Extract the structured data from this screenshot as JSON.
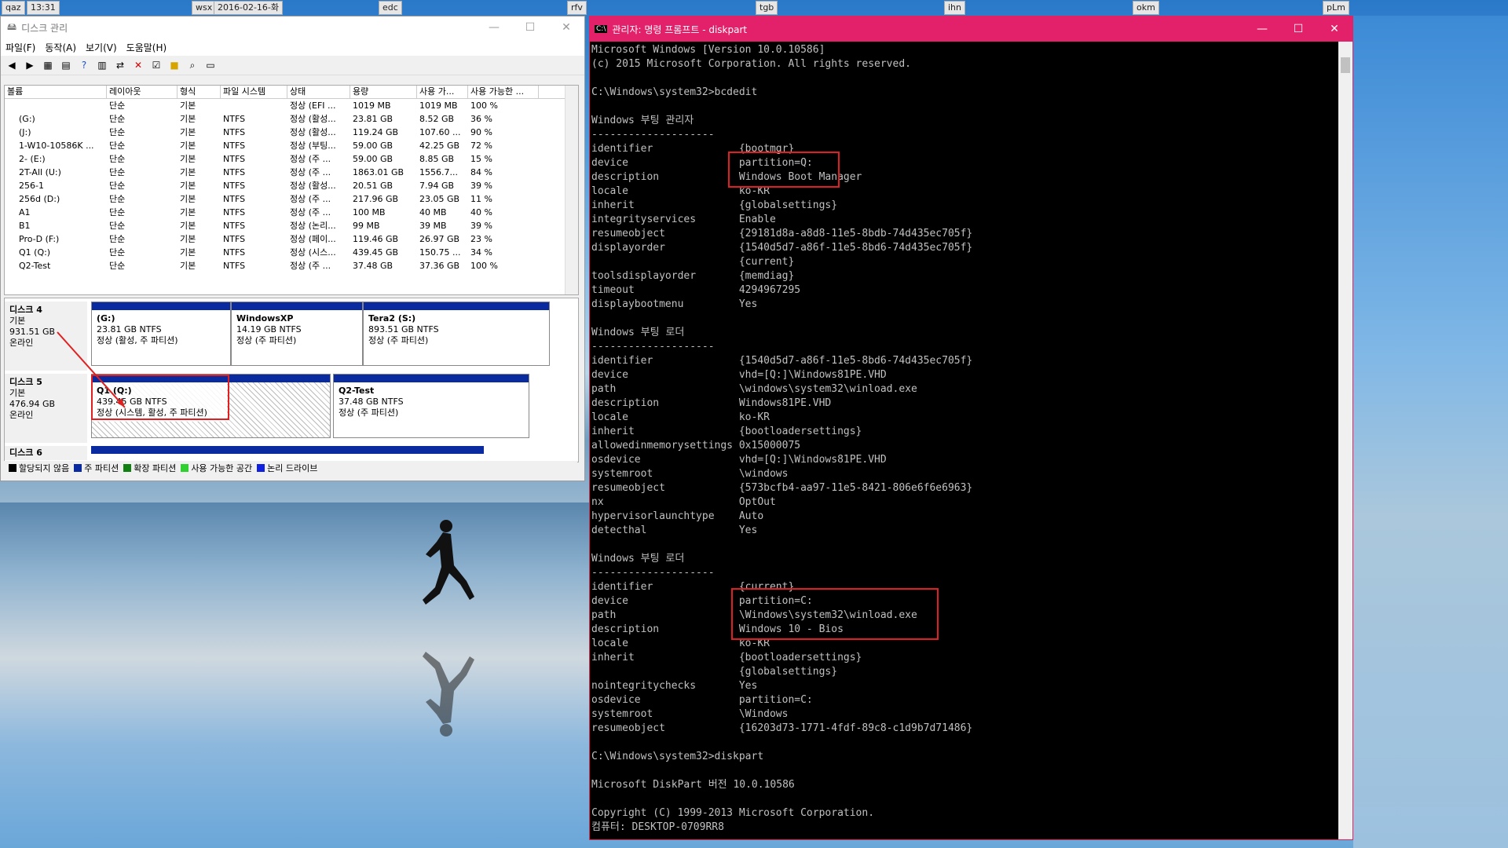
{
  "topbar": {
    "items": [
      "qaz",
      "13:31",
      "wsx",
      "2016-02-16-화",
      "edc",
      "rfv",
      "tgb",
      "ihn",
      "okm",
      "pLm"
    ]
  },
  "dm": {
    "title": "디스크 관리",
    "menu": [
      "파일(F)",
      "동작(A)",
      "보기(V)",
      "도움말(H)"
    ],
    "columns": [
      "볼륨",
      "레이아웃",
      "형식",
      "파일 시스템",
      "상태",
      "용량",
      "사용 가...",
      "사용 가능한 ..."
    ],
    "rows": [
      [
        "",
        "단순",
        "기본",
        "",
        "정상 (EFI ...",
        "1019 MB",
        "1019 MB",
        "100 %"
      ],
      [
        "(G:)",
        "단순",
        "기본",
        "NTFS",
        "정상 (활성...",
        "23.81 GB",
        "8.52 GB",
        "36 %"
      ],
      [
        "(J:)",
        "단순",
        "기본",
        "NTFS",
        "정상 (활성...",
        "119.24 GB",
        "107.60 ...",
        "90 %"
      ],
      [
        "1-W10-10586K ...",
        "단순",
        "기본",
        "NTFS",
        "정상 (부팅...",
        "59.00 GB",
        "42.25 GB",
        "72 %"
      ],
      [
        "2- (E:)",
        "단순",
        "기본",
        "NTFS",
        "정상 (주 ...",
        "59.00 GB",
        "8.85 GB",
        "15 %"
      ],
      [
        "2T-All (U:)",
        "단순",
        "기본",
        "NTFS",
        "정상 (주 ...",
        "1863.01 GB",
        "1556.7...",
        "84 %"
      ],
      [
        "256-1",
        "단순",
        "기본",
        "NTFS",
        "정상 (활성...",
        "20.51 GB",
        "7.94 GB",
        "39 %"
      ],
      [
        "256d (D:)",
        "단순",
        "기본",
        "NTFS",
        "정상 (주 ...",
        "217.96 GB",
        "23.05 GB",
        "11 %"
      ],
      [
        "A1",
        "단순",
        "기본",
        "NTFS",
        "정상 (주 ...",
        "100 MB",
        "40 MB",
        "40 %"
      ],
      [
        "B1",
        "단순",
        "기본",
        "NTFS",
        "정상 (논리...",
        "99 MB",
        "39 MB",
        "39 %"
      ],
      [
        "Pro-D (F:)",
        "단순",
        "기본",
        "NTFS",
        "정상 (페이...",
        "119.46 GB",
        "26.97 GB",
        "23 %"
      ],
      [
        "Q1 (Q:)",
        "단순",
        "기본",
        "NTFS",
        "정상 (시스...",
        "439.45 GB",
        "150.75 ...",
        "34 %"
      ],
      [
        "Q2-Test",
        "단순",
        "기본",
        "NTFS",
        "정상 (주 ...",
        "37.48 GB",
        "37.36 GB",
        "100 %"
      ]
    ],
    "disk4": {
      "name": "디스크 4",
      "type": "기본",
      "size": "931.51 GB",
      "state": "온라인",
      "parts": [
        {
          "label": "(G:)",
          "size": "23.81 GB NTFS",
          "status": "정상 (활성, 주 파티션)"
        },
        {
          "label": "WindowsXP",
          "size": "14.19 GB NTFS",
          "status": "정상 (주 파티션)"
        },
        {
          "label": "Tera2 (S:)",
          "size": "893.51 GB NTFS",
          "status": "정상 (주 파티션)"
        }
      ]
    },
    "disk5": {
      "name": "디스크 5",
      "type": "기본",
      "size": "476.94 GB",
      "state": "온라인",
      "parts": [
        {
          "label": "Q1 (Q:)",
          "size": "439.45 GB NTFS",
          "status": "정상 (시스템, 활성, 주 파티션)"
        },
        {
          "label": "Q2-Test",
          "size": "37.48 GB NTFS",
          "status": "정상 (주 파티션)"
        }
      ]
    },
    "disk6": {
      "name": "디스크 6"
    },
    "legend": [
      {
        "label": "할당되지 않음",
        "color": "#000000"
      },
      {
        "label": "주 파티션",
        "color": "#0a2aa0"
      },
      {
        "label": "확장 파티션",
        "color": "#108010"
      },
      {
        "label": "사용 가능한 공간",
        "color": "#30d030"
      },
      {
        "label": "논리 드라이브",
        "color": "#1020e0"
      }
    ]
  },
  "cmd": {
    "title": "관리자: 명령 프롬프트 - diskpart",
    "lines": [
      "Microsoft Windows [Version 10.0.10586]",
      "(c) 2015 Microsoft Corporation. All rights reserved.",
      "",
      "C:\\Windows\\system32>bcdedit",
      "",
      "Windows 부팅 관리자",
      "--------------------",
      "identifier              {bootmgr}",
      "device                  partition=Q:",
      "description             Windows Boot Manager",
      "locale                  ko-KR",
      "inherit                 {globalsettings}",
      "integrityservices       Enable",
      "resumeobject            {29181d8a-a8d8-11e5-8bdb-74d435ec705f}",
      "displayorder            {1540d5d7-a86f-11e5-8bd6-74d435ec705f}",
      "                        {current}",
      "toolsdisplayorder       {memdiag}",
      "timeout                 4294967295",
      "displaybootmenu         Yes",
      "",
      "Windows 부팅 로더",
      "--------------------",
      "identifier              {1540d5d7-a86f-11e5-8bd6-74d435ec705f}",
      "device                  vhd=[Q:]\\Windows81PE.VHD",
      "path                    \\windows\\system32\\winload.exe",
      "description             Windows81PE.VHD",
      "locale                  ko-KR",
      "inherit                 {bootloadersettings}",
      "allowedinmemorysettings 0x15000075",
      "osdevice                vhd=[Q:]\\Windows81PE.VHD",
      "systemroot              \\windows",
      "resumeobject            {573bcfb4-aa97-11e5-8421-806e6f6e6963}",
      "nx                      OptOut",
      "hypervisorlaunchtype    Auto",
      "detecthal               Yes",
      "",
      "Windows 부팅 로더",
      "--------------------",
      "identifier              {current}",
      "device                  partition=C:",
      "path                    \\Windows\\system32\\winload.exe",
      "description             Windows 10 - Bios",
      "locale                  ko-KR",
      "inherit                 {bootloadersettings}",
      "                        {globalsettings}",
      "nointegritychecks       Yes",
      "osdevice                partition=C:",
      "systemroot              \\Windows",
      "resumeobject            {16203d73-1771-4fdf-89c8-c1d9b7d71486}",
      "",
      "C:\\Windows\\system32>diskpart",
      "",
      "Microsoft DiskPart 버전 10.0.10586",
      "",
      "Copyright (C) 1999-2013 Microsoft Corporation.",
      "컴퓨터: DESKTOP-0709RR8"
    ]
  }
}
